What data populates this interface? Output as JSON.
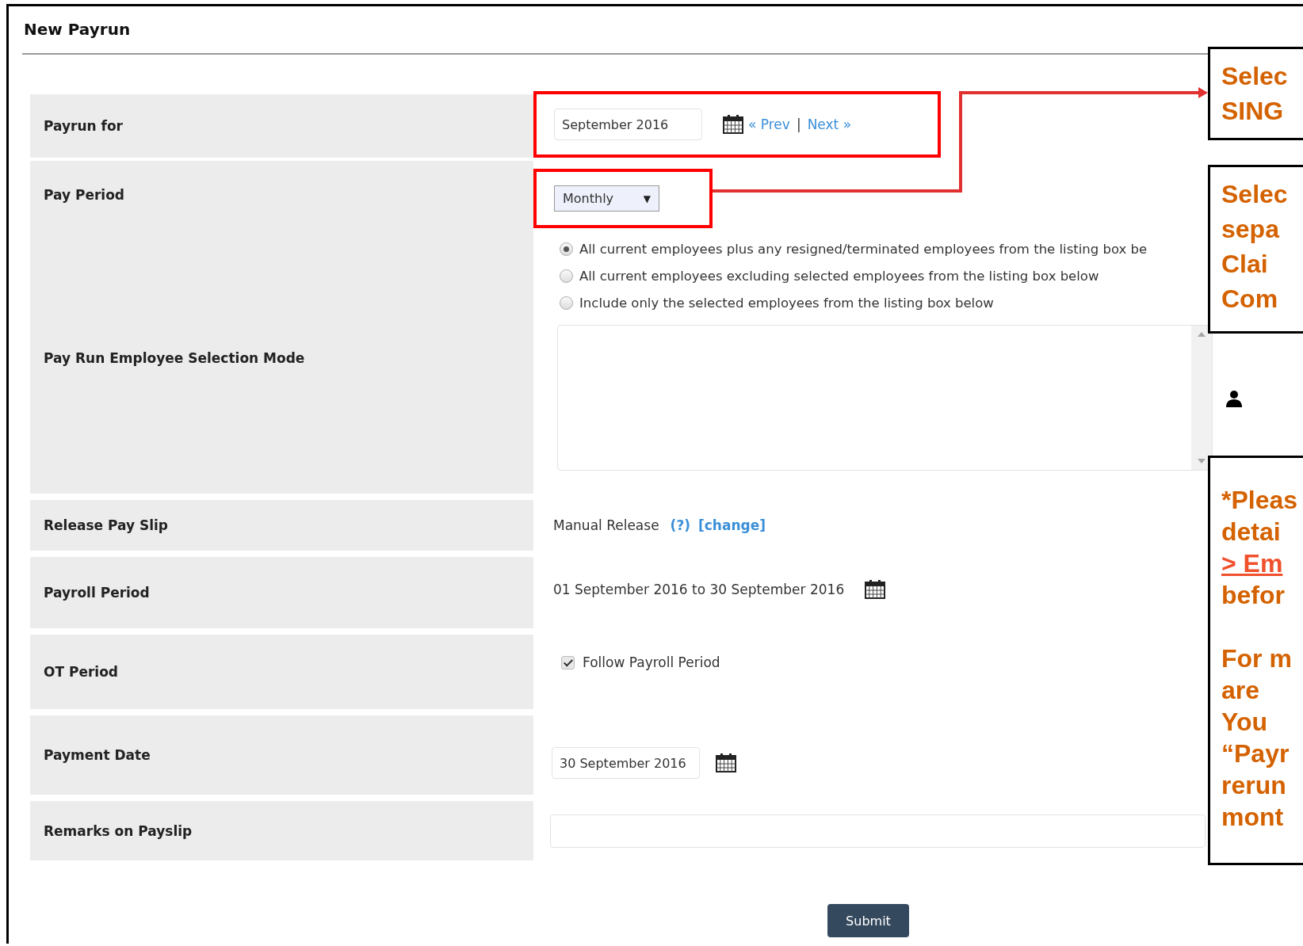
{
  "page": {
    "title": "New Payrun"
  },
  "form": {
    "rows": [
      {
        "label": "Payrun for",
        "kind": "month_picker",
        "highlighted": true,
        "value": "September 2016",
        "prev": "« Prev",
        "separator": "|",
        "next": "Next »"
      },
      {
        "label": "Pay Period",
        "kind": "select",
        "highlighted": true,
        "value": "Monthly",
        "caret": "▼"
      },
      {
        "label": "Pay Run Employee Selection Mode",
        "kind": "radio_list",
        "highlighted": false,
        "options": [
          {
            "text": "All current employees plus any resigned/terminated employees from the listing box be",
            "selected": true
          },
          {
            "text": "All current employees excluding selected employees from the listing box below",
            "selected": false
          },
          {
            "text": "Include only the selected employees from the listing box below",
            "selected": false
          }
        ]
      },
      {
        "label": "Release Pay Slip",
        "kind": "release",
        "highlighted": false,
        "value": "Manual Release",
        "help": "(?)",
        "change": "[change]"
      },
      {
        "label": "Payroll Period",
        "kind": "period",
        "highlighted": false,
        "value": "01 September 2016 to 30 September 2016"
      },
      {
        "label": "OT Period",
        "kind": "checkbox",
        "highlighted": false,
        "value": "Follow Payroll Period",
        "checked": true
      },
      {
        "label": "Payment Date",
        "kind": "date",
        "highlighted": false,
        "value": "30 September 2016"
      },
      {
        "label": "Remarks on Payslip",
        "kind": "text",
        "highlighted": false
      }
    ],
    "submit": "Submit"
  },
  "callouts": [
    {
      "paragraphs": [
        [
          {
            "text": "Selec",
            "link": false
          },
          {
            "text": "SING",
            "link": false
          }
        ]
      ]
    },
    {
      "paragraphs": [
        [
          {
            "text": "Selec",
            "link": false
          },
          {
            "text": "sepa",
            "link": false
          },
          {
            "text": "Clai",
            "link": false
          },
          {
            "text": "Com",
            "link": false
          }
        ]
      ]
    },
    {
      "paragraphs": [
        [
          {
            "text": "*Pleas",
            "link": false
          },
          {
            "text": "detai",
            "link": false
          },
          {
            "text": "> Em",
            "link": true
          },
          {
            "text": "befor",
            "link": false
          }
        ],
        [
          {
            "text": "For m",
            "link": false
          },
          {
            "text": "are",
            "link": false
          },
          {
            "text": "You",
            "link": false
          },
          {
            "text": "“Payr",
            "link": false
          },
          {
            "text": "rerun",
            "link": false
          },
          {
            "text": "mont",
            "link": false
          }
        ]
      ]
    }
  ]
}
